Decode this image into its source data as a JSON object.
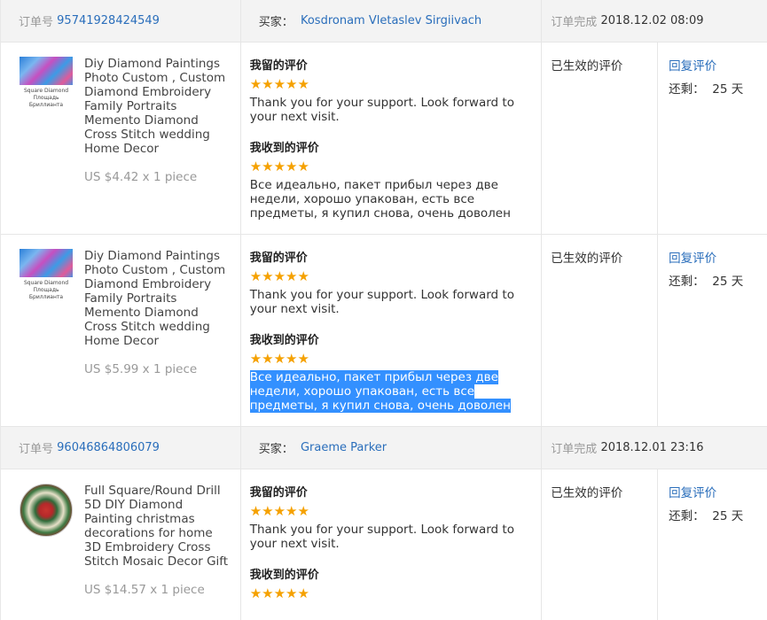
{
  "labels": {
    "order_no": "订单号",
    "buyer": "买家：",
    "order_done": "订单完成",
    "my_review": "我留的评价",
    "received_review": "我收到的评价",
    "status": "已生效的评价",
    "reply": "回复评价",
    "remaining": "还剩：",
    "days": "25 天",
    "stars": "★★★★★",
    "thumb_caption_1": "Square Diamond",
    "thumb_caption_2": "Площадь Бриллианта"
  },
  "orders": [
    {
      "order_no": "95741928424549",
      "buyer": "Kosdronam Vletaslev Sirgiivach",
      "completed": "2018.12.02 08:09",
      "items": [
        {
          "title": "Diy Diamond Paintings Photo Custom , Custom Diamond Embroidery Family Portraits Memento Diamond Cross Stitch wedding Home Decor",
          "price": "US $4.42 x 1 piece",
          "my_text": "Thank you for your support. Look forward to your next visit.",
          "recv_text": "Все идеально, пакет прибыл через две недели, хорошо упакован, есть все предметы, я купил снова, очень доволен"
        },
        {
          "title": "Diy Diamond Paintings Photo Custom , Custom Diamond Embroidery Family Portraits Memento Diamond Cross Stitch wedding Home Decor",
          "price": "US $5.99 x 1 piece",
          "my_text": "Thank you for your support. Look forward to your next visit.",
          "recv_text": "Все идеально, пакет прибыл через две недели, хорошо упакован, есть все предметы, я купил снова, очень доволен"
        }
      ]
    },
    {
      "order_no": "96046864806079",
      "buyer": "Graeme Parker",
      "completed": "2018.12.01 23:16",
      "items": [
        {
          "title": "Full Square/Round Drill 5D DIY Diamond Painting christmas decorations for home 3D Embroidery Cross Stitch Mosaic Decor Gift",
          "price": "US $14.57 x 1 piece",
          "my_text": "Thank you for your support. Look forward to your next visit."
        }
      ]
    }
  ]
}
